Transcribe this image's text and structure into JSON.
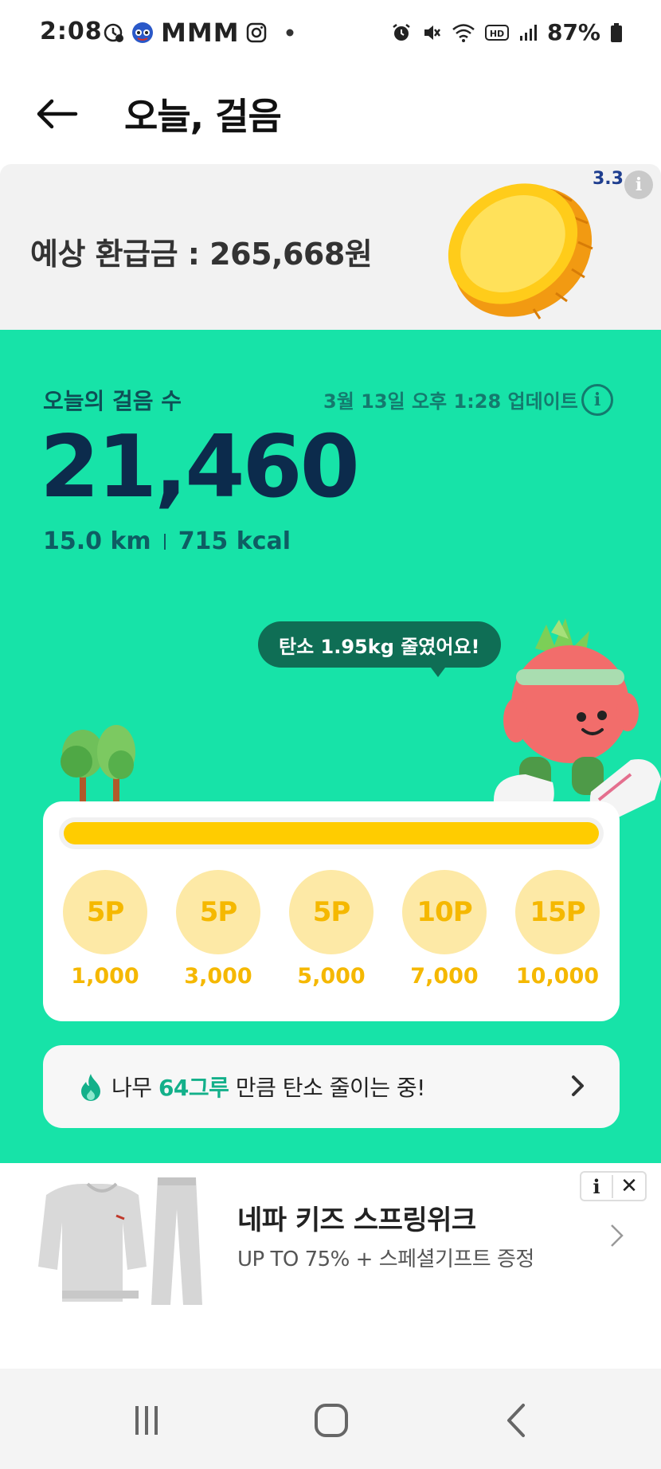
{
  "status_bar": {
    "time": "2:08",
    "carrier_text": "MMM",
    "battery": "87%",
    "icons": [
      "clock-alert-icon",
      "avatar-icon",
      "instagram-icon",
      "dot-icon",
      "alarm-icon",
      "mute-icon",
      "wifi-icon",
      "hd-icon",
      "signal-icon",
      "battery-icon"
    ]
  },
  "header": {
    "title": "오늘, 걸음",
    "back_icon": "arrow-left-icon"
  },
  "refund": {
    "text": "예상 환급금 : 265,668원",
    "brand_badge": "3.3",
    "info_icon": "info-icon"
  },
  "steps": {
    "label": "오늘의 걸음 수",
    "updated": "3월 13일 오후 1:28 업데이트",
    "count": "21,460",
    "distance": "15.0 km",
    "calories": "715 kcal",
    "carbon_message": "탄소 1.95kg 줄였어요!"
  },
  "progress": {
    "fraction": 1.0,
    "milestones": [
      {
        "reward": "5P",
        "steps": "1,000"
      },
      {
        "reward": "5P",
        "steps": "3,000"
      },
      {
        "reward": "5P",
        "steps": "5,000"
      },
      {
        "reward": "10P",
        "steps": "7,000"
      },
      {
        "reward": "15P",
        "steps": "10,000"
      }
    ]
  },
  "tree_banner": {
    "prefix": "나무",
    "count": "64그루",
    "suffix": "만큼 탄소 줄이는 중!"
  },
  "ad": {
    "title": "네파 키즈 스프링위크",
    "subtitle": "UP TO 75% + 스페셜기프트 증정",
    "info_label": "i",
    "close_label": "✕"
  },
  "nav": {
    "recents_icon": "recents-icon",
    "home_icon": "home-icon",
    "back_icon": "back-icon"
  },
  "colors": {
    "green": "#17e3a8",
    "yellow": "#ffcc00",
    "navy": "#0c2b4c",
    "teal_text": "#13b08a"
  }
}
